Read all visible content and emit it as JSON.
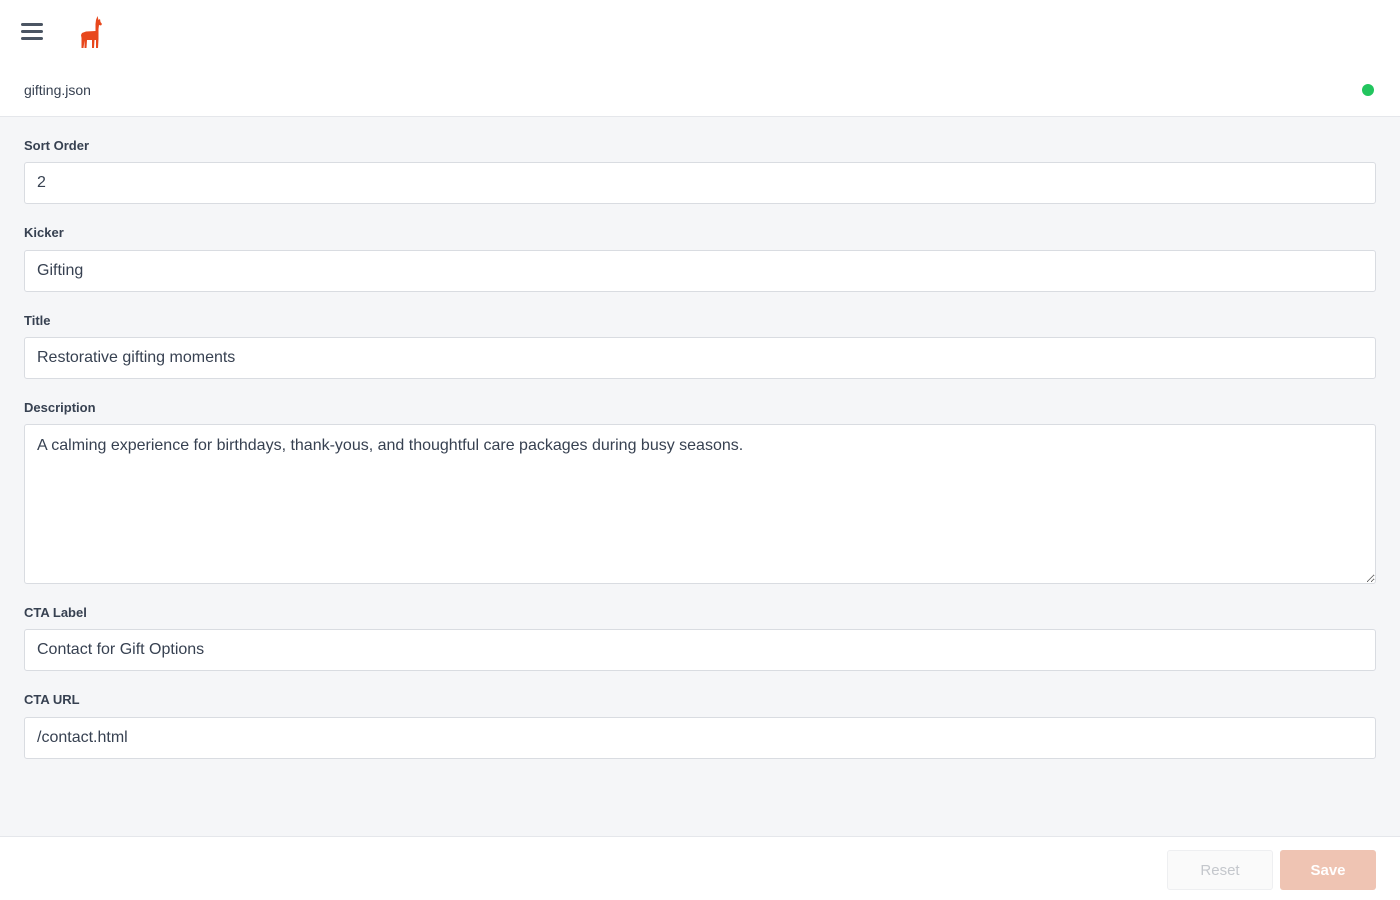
{
  "header": {
    "menu_icon": "hamburger-menu-icon",
    "logo_icon": "llama-logo-icon",
    "logo_color": "#e8471c"
  },
  "file": {
    "name": "gifting.json",
    "status_color": "#22c55e"
  },
  "form": {
    "sort_order": {
      "label": "Sort Order",
      "value": "2"
    },
    "kicker": {
      "label": "Kicker",
      "value": "Gifting"
    },
    "title": {
      "label": "Title",
      "value": "Restorative gifting moments"
    },
    "description": {
      "label": "Description",
      "value": "A calming experience for birthdays, thank-yous, and thoughtful care packages during busy seasons."
    },
    "cta_label": {
      "label": "CTA Label",
      "value": "Contact for Gift Options"
    },
    "cta_url": {
      "label": "CTA URL",
      "value": "/contact.html"
    }
  },
  "footer": {
    "reset_label": "Reset",
    "save_label": "Save",
    "save_color": "#efc4b3"
  }
}
